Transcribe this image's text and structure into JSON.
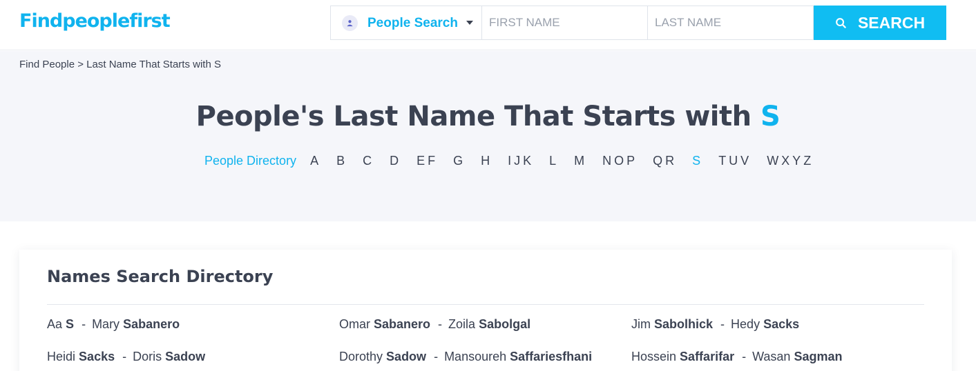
{
  "header": {
    "logo": "Findpeoplefirst",
    "search_type": "People Search",
    "first_name_placeholder": "FIRST NAME",
    "last_name_placeholder": "LAST NAME",
    "search_button": "SEARCH"
  },
  "breadcrumb": {
    "home": "Find People",
    "separator": " > ",
    "current": "Last Name That Starts with S"
  },
  "hero": {
    "title_prefix": "People's Last Name That Starts with ",
    "title_letter": "S"
  },
  "alpha_nav": {
    "directory_label": "People Directory",
    "letters": [
      "A",
      "B",
      "C",
      "D",
      "EF",
      "G",
      "H",
      "IJK",
      "L",
      "M",
      "NOP",
      "QR",
      "S",
      "TUV",
      "WXYZ"
    ],
    "active": "S"
  },
  "directory": {
    "title": "Names Search Directory",
    "pairs": [
      {
        "a_first": "Aa",
        "a_last": "S",
        "b_first": "Mary",
        "b_last": "Sabanero"
      },
      {
        "a_first": "Omar",
        "a_last": "Sabanero",
        "b_first": "Zoila",
        "b_last": "Sabolgal"
      },
      {
        "a_first": "Jim",
        "a_last": "Sabolhick",
        "b_first": "Hedy",
        "b_last": "Sacks"
      },
      {
        "a_first": "Heidi",
        "a_last": "Sacks",
        "b_first": "Doris",
        "b_last": "Sadow"
      },
      {
        "a_first": "Dorothy",
        "a_last": "Sadow",
        "b_first": "Mansoureh",
        "b_last": "Saffariesfhani"
      },
      {
        "a_first": "Hossein",
        "a_last": "Saffarifar",
        "b_first": "Wasan",
        "b_last": "Sagman"
      }
    ]
  },
  "colors": {
    "brand": "#10b3ee",
    "button": "#10bdf2",
    "text": "#3b4252",
    "hero_bg": "#f5f6fa"
  }
}
